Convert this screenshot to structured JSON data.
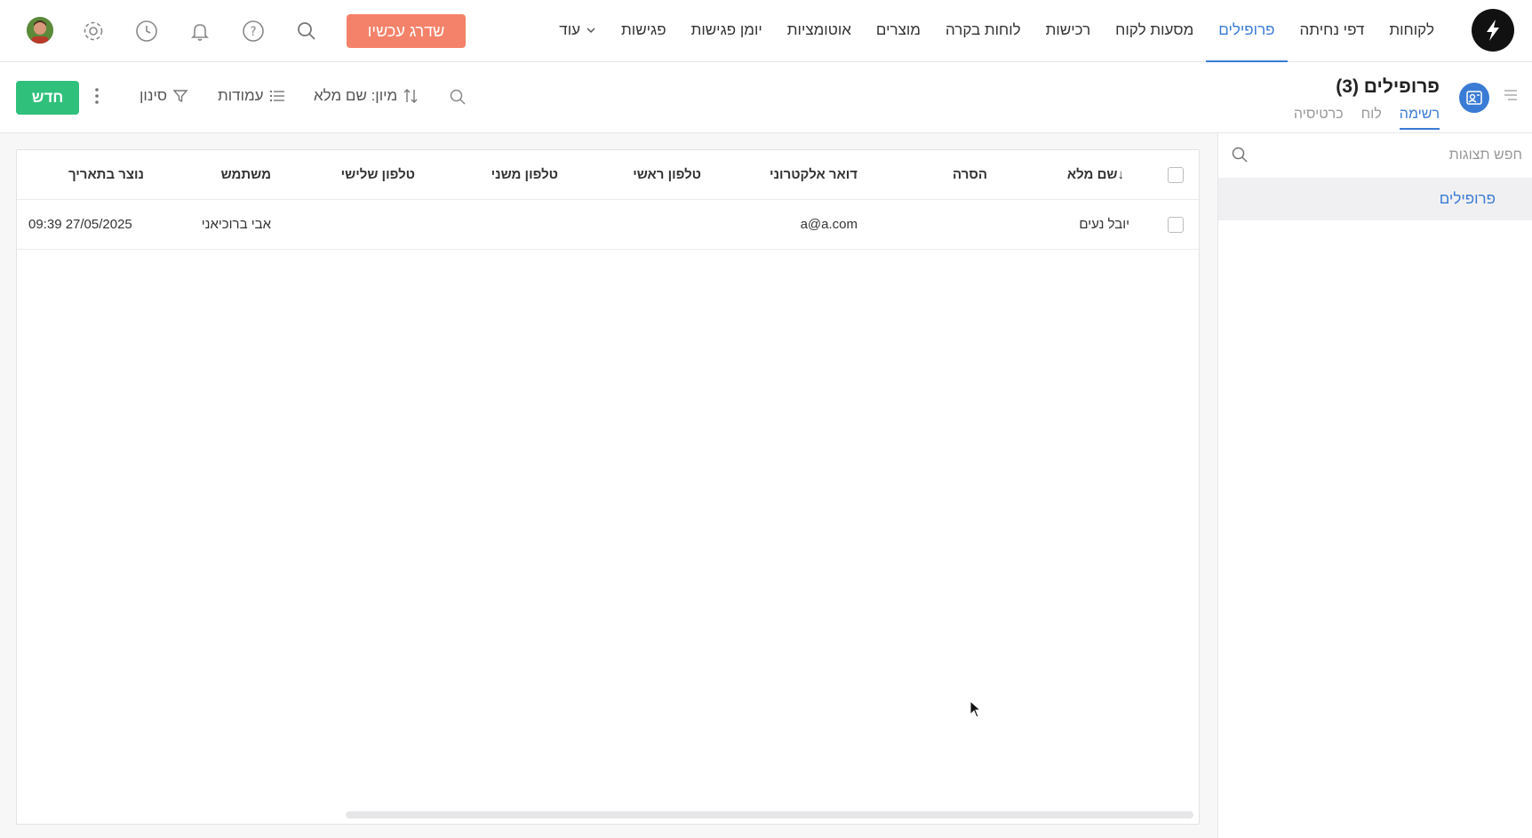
{
  "nav": {
    "items": [
      {
        "label": "לקוחות",
        "active": false
      },
      {
        "label": "דפי נחיתה",
        "active": false
      },
      {
        "label": "פרופילים",
        "active": true
      },
      {
        "label": "מסעות לקוח",
        "active": false
      },
      {
        "label": "רכישות",
        "active": false
      },
      {
        "label": "לוחות בקרה",
        "active": false
      },
      {
        "label": "מוצרים",
        "active": false
      },
      {
        "label": "אוטומציות",
        "active": false
      },
      {
        "label": "יומן פגישות",
        "active": false
      },
      {
        "label": "פגישות",
        "active": false
      }
    ],
    "more_label": "עוד",
    "upgrade_label": "שדרג עכשיו",
    "accent": "#3a7bd5",
    "upgrade_color": "#f4826a"
  },
  "header": {
    "title": "פרופילים (3)",
    "tabs": [
      {
        "label": "רשימה",
        "active": true
      },
      {
        "label": "לוח",
        "active": false
      },
      {
        "label": "כרטיסיה",
        "active": false
      }
    ]
  },
  "toolbar": {
    "new_label": "חדש",
    "filter_label": "סינון",
    "columns_label": "עמודות",
    "sort_label": "מיון: שם מלא",
    "new_color": "#2fc07b"
  },
  "sidebar": {
    "search_placeholder": "חפש תצוגות",
    "items": [
      {
        "label": "פרופילים"
      }
    ]
  },
  "table": {
    "columns": [
      "שם מלא",
      "הסרה",
      "דואר אלקטרוני",
      "טלפון ראשי",
      "טלפון משני",
      "טלפון שלישי",
      "משתמש",
      "נוצר בתאריך"
    ],
    "sort_indicator": "↓",
    "rows": [
      {
        "name": "יובל נעים",
        "removal": "",
        "email": "a@a.com",
        "phone1": "",
        "phone2": "",
        "phone3": "",
        "user": "אבי ברוכיאני",
        "created": "09:39 27/05/2025"
      }
    ]
  }
}
